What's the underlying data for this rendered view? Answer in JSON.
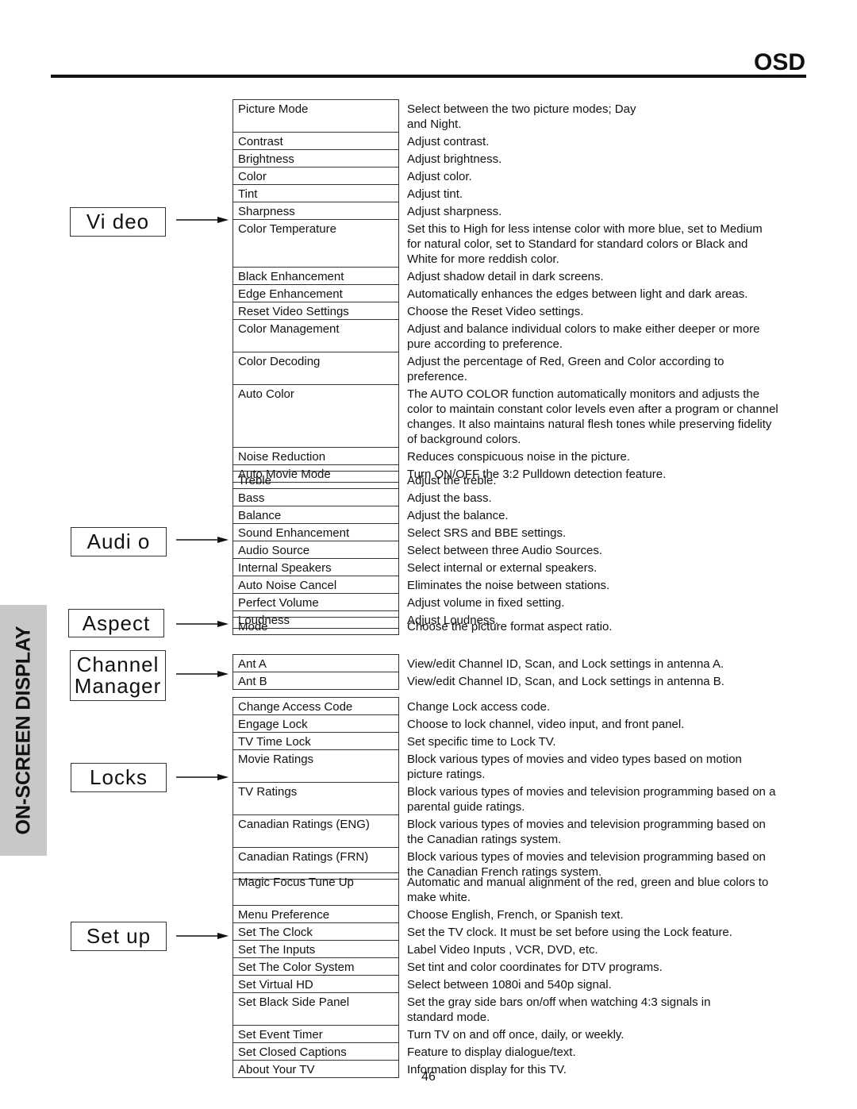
{
  "header": {
    "title": "OSD"
  },
  "side_tab": {
    "label": "ON-SCREEN DISPLAY"
  },
  "page_number": "46",
  "sections": [
    {
      "label": "Vi deo",
      "items": [
        {
          "name": "Picture Mode",
          "desc": "Select between the two picture modes; Day\nand Night."
        },
        {
          "name": "Contrast",
          "desc": "Adjust contrast."
        },
        {
          "name": "Brightness",
          "desc": "Adjust brightness."
        },
        {
          "name": "Color",
          "desc": "Adjust color."
        },
        {
          "name": "Tint",
          "desc": "Adjust tint."
        },
        {
          "name": "Sharpness",
          "desc": "Adjust sharpness."
        },
        {
          "name": "Color Temperature",
          "desc": "Set this to High for less intense color with more blue, set to Medium\nfor natural color, set to Standard for standard colors or Black and\nWhite for more reddish color."
        },
        {
          "name": "Black Enhancement",
          "desc": "Adjust shadow detail in dark screens."
        },
        {
          "name": "Edge Enhancement",
          "desc": "Automatically enhances the edges between light and dark areas."
        },
        {
          "name": "Reset Video Settings",
          "desc": "Choose the Reset Video settings."
        },
        {
          "name": "Color Management",
          "desc": "Adjust and balance individual colors to make either deeper or more\npure according to preference."
        },
        {
          "name": "Color Decoding",
          "desc": "Adjust the percentage of Red, Green and Color according to\npreference."
        },
        {
          "name": "Auto Color",
          "desc": "The AUTO COLOR function automatically monitors and adjusts the\ncolor to maintain constant color levels even after a program or channel\nchanges. It also maintains natural flesh tones while preserving fidelity\nof background colors."
        },
        {
          "name": "Noise Reduction",
          "desc": "Reduces conspicuous noise in the picture."
        },
        {
          "name": "Auto Movie Mode",
          "desc": "Turn ON/OFF the 3:2 Pulldown detection feature."
        }
      ]
    },
    {
      "label": "Audi o",
      "items": [
        {
          "name": "Treble",
          "desc": "Adjust the treble."
        },
        {
          "name": "Bass",
          "desc": "Adjust the bass."
        },
        {
          "name": "Balance",
          "desc": "Adjust the balance."
        },
        {
          "name": "Sound Enhancement",
          "desc": "Select SRS and BBE settings."
        },
        {
          "name": "Audio Source",
          "desc": "Select between three Audio Sources."
        },
        {
          "name": "Internal Speakers",
          "desc": "Select internal or external speakers."
        },
        {
          "name": "Auto Noise Cancel",
          "desc": "Eliminates the noise between stations."
        },
        {
          "name": "Perfect Volume",
          "desc": "Adjust volume in fixed setting."
        },
        {
          "name": "Loudness",
          "desc": "Adjust Loudness."
        }
      ]
    },
    {
      "label": "Aspect",
      "items": [
        {
          "name": "Mode",
          "desc": "Choose the picture format aspect ratio."
        }
      ]
    },
    {
      "label": "Channel\nManager",
      "items": [
        {
          "name": "Ant A",
          "desc": "View/edit Channel ID, Scan, and Lock settings in antenna A."
        },
        {
          "name": "Ant B",
          "desc": "View/edit Channel ID, Scan, and Lock settings in antenna B."
        }
      ]
    },
    {
      "label": "Locks",
      "items": [
        {
          "name": "Change Access Code",
          "desc": "Change Lock access code."
        },
        {
          "name": "Engage Lock",
          "desc": "Choose to lock channel, video input, and front panel."
        },
        {
          "name": "TV Time Lock",
          "desc": "Set specific time to Lock TV."
        },
        {
          "name": "Movie Ratings",
          "desc": "Block various types of movies and video types based on motion\npicture ratings."
        },
        {
          "name": "TV Ratings",
          "desc": "Block various types of movies and television programming based on a\nparental guide ratings."
        },
        {
          "name": "Canadian Ratings (ENG)",
          "desc": "Block various types of movies and television programming based on\nthe Canadian ratings system."
        },
        {
          "name": "Canadian Ratings (FRN)",
          "desc": "Block various types of movies and television programming based on\nthe Canadian French ratings system."
        }
      ]
    },
    {
      "label": "Set up",
      "items": [
        {
          "name": "Magic Focus Tune Up",
          "desc": "Automatic and manual alignment of the red, green and blue colors to\n        make white."
        },
        {
          "name": "Menu Preference",
          "desc": "Choose English, French, or Spanish text."
        },
        {
          "name": "Set The Clock",
          "desc": "Set the TV clock.  It must be set before using the Lock feature."
        },
        {
          "name": "Set The Inputs",
          "desc": "Label Video Inputs , VCR, DVD, etc."
        },
        {
          "name": "Set The Color System",
          "desc": "Set tint and color coordinates for DTV programs."
        },
        {
          "name": "Set Virtual HD",
          "desc": "Select between 1080i and 540p signal."
        },
        {
          "name": "Set Black Side Panel",
          "desc": "Set the gray side bars on/off when watching 4:3 signals in\nstandard mode."
        },
        {
          "name": "Set Event Timer",
          "desc": "Turn TV on and off once, daily, or weekly."
        },
        {
          "name": "Set Closed Captions",
          "desc": "Feature to display dialogue/text."
        },
        {
          "name": "About Your TV",
          "desc": "Information display for this TV."
        }
      ]
    }
  ]
}
